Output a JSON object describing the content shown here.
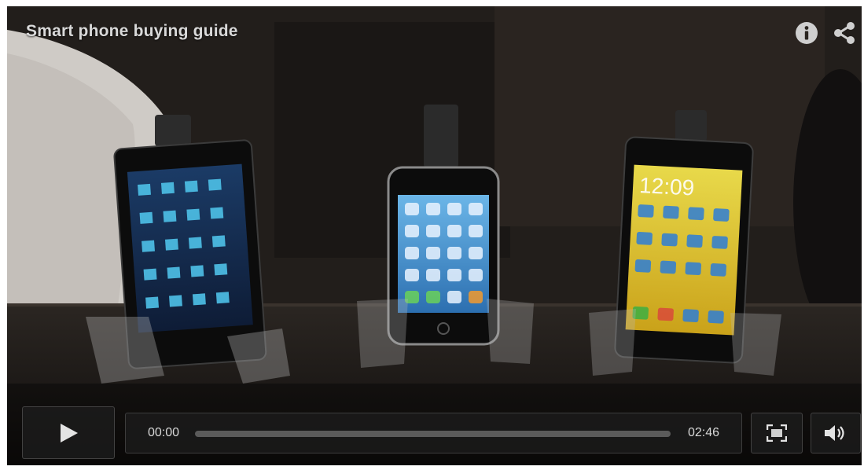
{
  "video": {
    "title": "Smart phone buying guide"
  },
  "controls": {
    "current_time": "00:00",
    "duration": "02:46",
    "progress_fraction": 0.0
  },
  "icons": {
    "info": "info-icon",
    "share": "share-icon",
    "play": "play-icon",
    "fullscreen": "fullscreen-icon",
    "volume": "volume-icon"
  },
  "colors": {
    "text": "#d9d9d9",
    "control_bg": "#1e1e1e",
    "track": "#5b5b5b"
  }
}
